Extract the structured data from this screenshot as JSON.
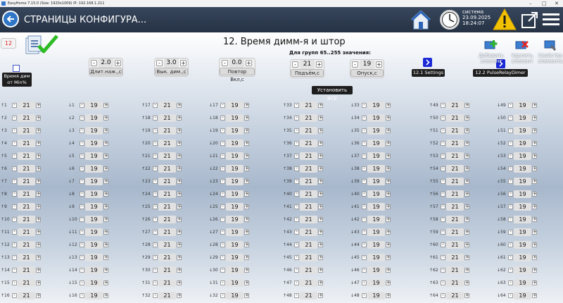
{
  "window": {
    "title": "EasyHome 7.15.0 (Size: 1920x1009) IP: 192.168.1.211",
    "controls": [
      "–",
      "□",
      "✕"
    ]
  },
  "header": {
    "title": "СТРАНИЦЫ КОНФИГУРА...",
    "system_label": "система",
    "date": "23.09.2025",
    "time": "18:24:07"
  },
  "page": {
    "number": "12",
    "title": "12. Время димм-я и штор",
    "group_values_label": "Для групп 65..255 значения:",
    "min_percent_label": "Время дим от Min%",
    "set_all_label": "Установить ВСЕ"
  },
  "controls": [
    {
      "value": "2.0",
      "label": "Длит.наж.,с"
    },
    {
      "value": "3.0",
      "label": "Вык. дим.,с"
    },
    {
      "value": "0.0",
      "label": "Повтор Вкл,с"
    },
    {
      "value": "21",
      "label": "Подъём,с"
    },
    {
      "value": "19",
      "label": "Опуск,с"
    }
  ],
  "links": {
    "settings": "12.1 Settings",
    "pulse_relay": "12.2 PulseRelayDimer"
  },
  "toolbar": {
    "add": "Добавить элемент",
    "delete": "Удалить элемент",
    "properties": "Свойства элемента"
  },
  "grid": {
    "columns": [
      {
        "dir": "↑",
        "start": 1,
        "value": "21"
      },
      {
        "dir": "↓",
        "start": 1,
        "value": "19"
      },
      {
        "dir": "↑",
        "start": 17,
        "value": "21"
      },
      {
        "dir": "↓",
        "start": 17,
        "value": "19"
      },
      {
        "dir": "↑",
        "start": 33,
        "value": "21"
      },
      {
        "dir": "↓",
        "start": 33,
        "value": "19"
      },
      {
        "dir": "↑",
        "start": 49,
        "value": "21"
      },
      {
        "dir": "↓",
        "start": 49,
        "value": "19"
      }
    ],
    "rows": 16
  },
  "icons": {
    "back": "back-arrow-icon",
    "home": "home-icon",
    "clock": "clock-icon",
    "warning": "warning-icon",
    "exit": "exit-window-icon",
    "menu": "hamburger-menu-icon",
    "save": "save-check-icon"
  },
  "colors": {
    "header": "#2e3a4e",
    "accent_blue": "#1c29d6",
    "warning": "#f2c200",
    "page_number": "#dd2222"
  }
}
